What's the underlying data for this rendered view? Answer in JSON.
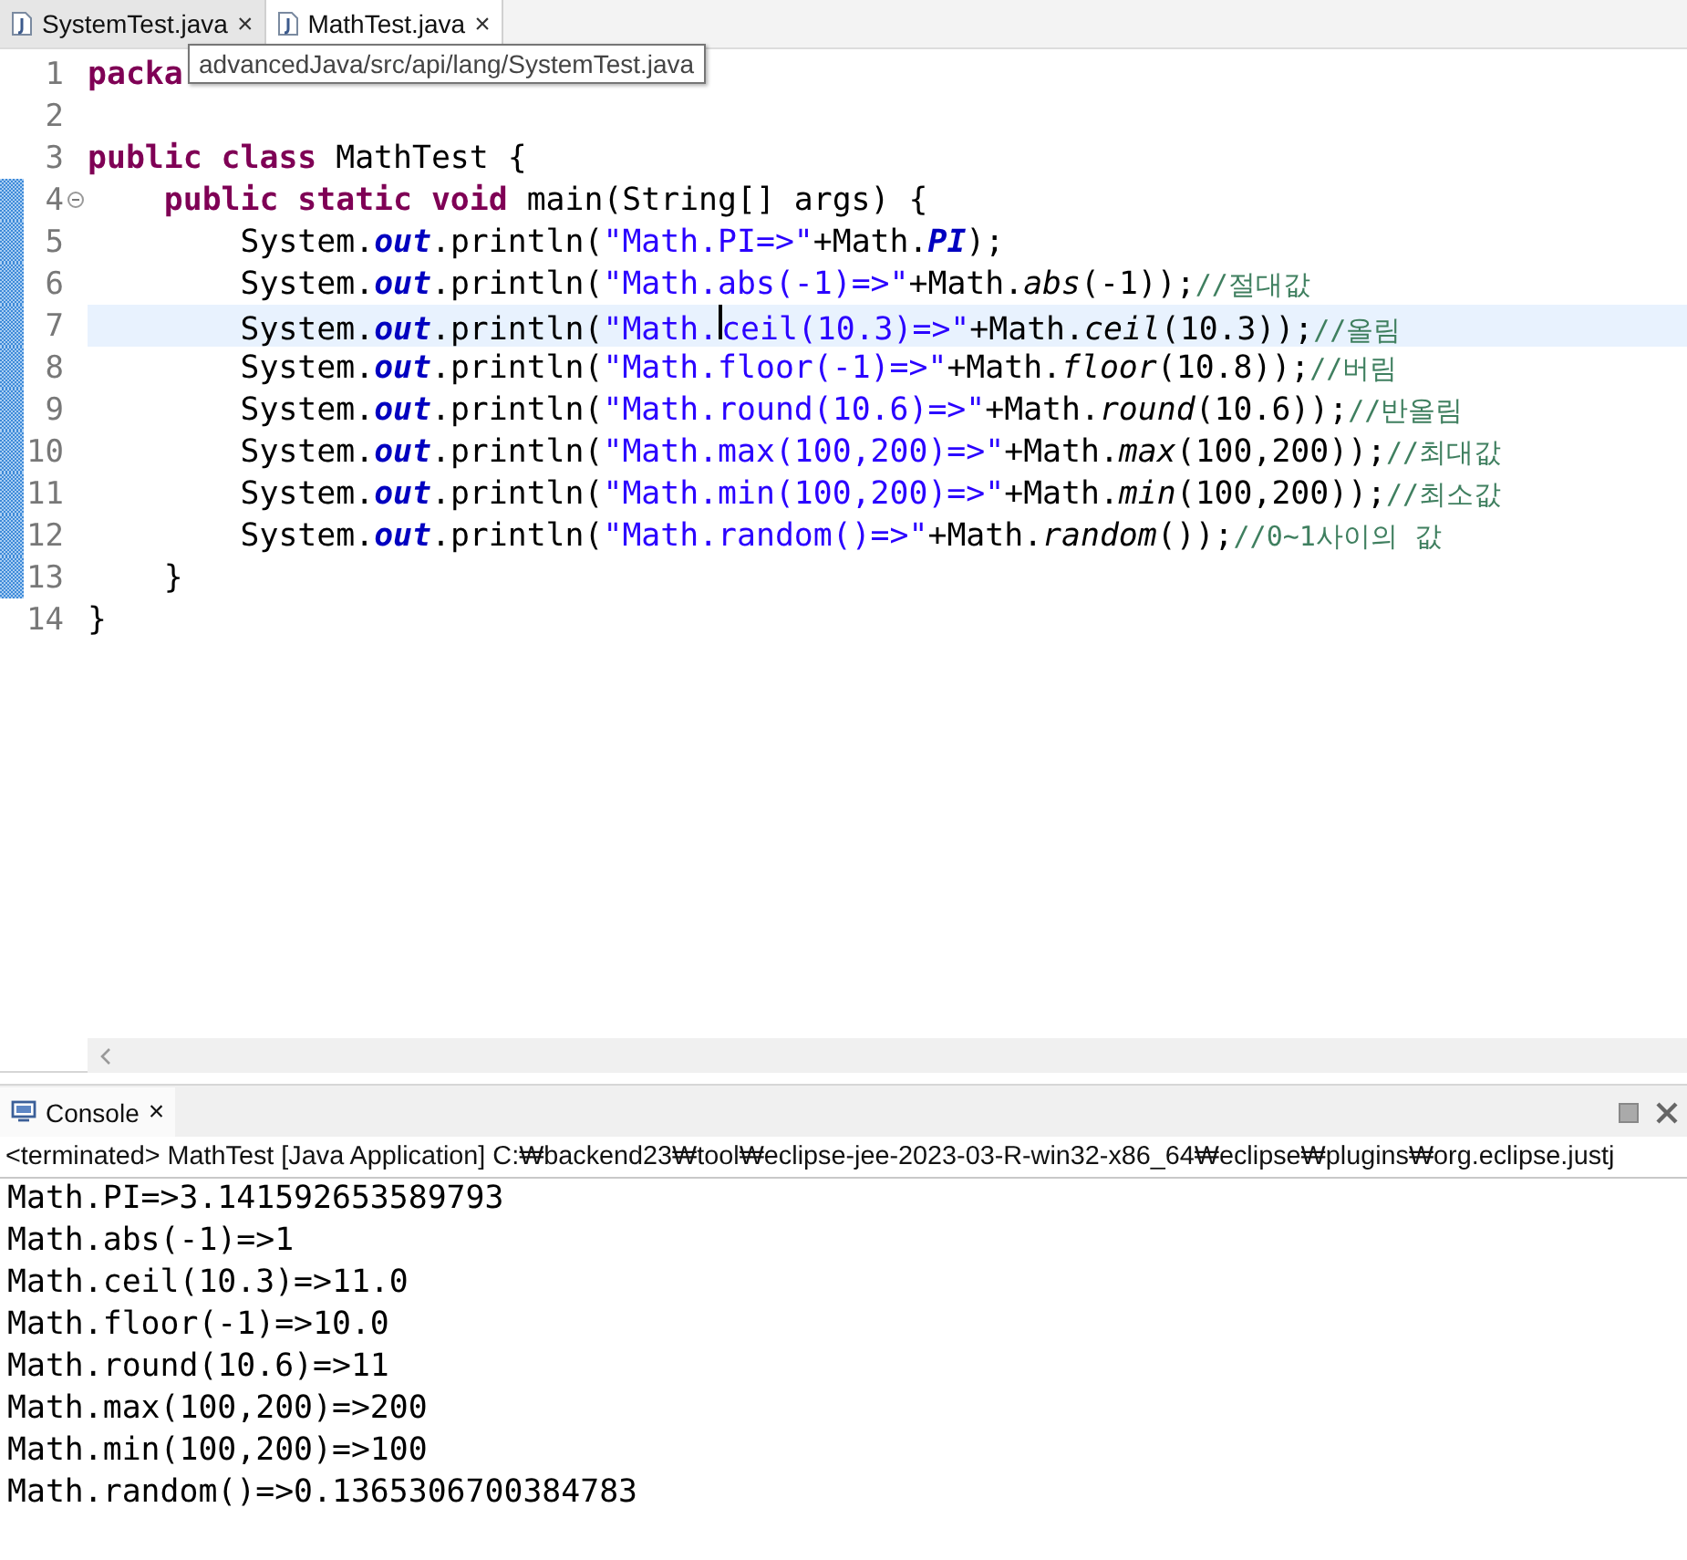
{
  "editor_tabs": [
    {
      "label": "SystemTest.java",
      "selected": false,
      "close": "×"
    },
    {
      "label": "MathTest.java",
      "selected": true,
      "close": "×"
    }
  ],
  "tooltip": "advancedJava/src/api/lang/SystemTest.java",
  "lines": [
    {
      "number": "1",
      "changed": false,
      "current": false,
      "tokens": [
        {
          "kind": "keyword",
          "text": "packa"
        }
      ]
    },
    {
      "number": "2",
      "changed": false,
      "current": false
    },
    {
      "number": "3",
      "changed": false,
      "current": false,
      "tokens": [
        {
          "kind": "keyword",
          "text": "public class"
        },
        {
          "kind": "plain",
          "text": " MathTest {"
        }
      ]
    },
    {
      "number": "4",
      "changed": true,
      "current": false,
      "collapsed": false,
      "tokens": [
        {
          "kind": "keyword",
          "text": "    public static void"
        },
        {
          "kind": "plain",
          "text": " main(String[] args) {"
        }
      ]
    },
    {
      "number": "5",
      "changed": true,
      "current": false,
      "tokens": [
        {
          "kind": "plain",
          "text": "        System."
        },
        {
          "kind": "field",
          "text": "out"
        },
        {
          "kind": "plain",
          "text": ".println("
        },
        {
          "kind": "string",
          "text": "\"Math.PI=>\""
        },
        {
          "kind": "plain",
          "text": "+Math."
        },
        {
          "kind": "field",
          "text": "PI"
        },
        {
          "kind": "plain",
          "text": ");"
        }
      ]
    },
    {
      "number": "6",
      "changed": true,
      "current": false,
      "tokens": [
        {
          "kind": "plain",
          "text": "        System."
        },
        {
          "kind": "field",
          "text": "out"
        },
        {
          "kind": "plain",
          "text": ".println("
        },
        {
          "kind": "string",
          "text": "\"Math.abs(-1)=>\""
        },
        {
          "kind": "plain",
          "text": "+Math."
        },
        {
          "kind": "static",
          "text": "abs"
        },
        {
          "kind": "plain",
          "text": "(-1));"
        },
        {
          "kind": "comment",
          "text": "//절대값"
        }
      ]
    },
    {
      "number": "7",
      "changed": true,
      "current": true,
      "tokens": [
        {
          "kind": "plain",
          "text": "        System."
        },
        {
          "kind": "field",
          "text": "out"
        },
        {
          "kind": "plain",
          "text": ".println("
        },
        {
          "kind": "string",
          "text": "\"Math."
        },
        {
          "kind": "caret"
        },
        {
          "kind": "string",
          "text": "ceil(10.3)=>\""
        },
        {
          "kind": "plain",
          "text": "+Math."
        },
        {
          "kind": "static",
          "text": "ceil"
        },
        {
          "kind": "plain",
          "text": "(10.3));"
        },
        {
          "kind": "comment",
          "text": "//올림"
        }
      ]
    },
    {
      "number": "8",
      "changed": true,
      "current": false,
      "tokens": [
        {
          "kind": "plain",
          "text": "        System."
        },
        {
          "kind": "field",
          "text": "out"
        },
        {
          "kind": "plain",
          "text": ".println("
        },
        {
          "kind": "string",
          "text": "\"Math.floor(-1)=>\""
        },
        {
          "kind": "plain",
          "text": "+Math."
        },
        {
          "kind": "static",
          "text": "floor"
        },
        {
          "kind": "plain",
          "text": "(10.8));"
        },
        {
          "kind": "comment",
          "text": "//버림"
        }
      ]
    },
    {
      "number": "9",
      "changed": true,
      "current": false,
      "tokens": [
        {
          "kind": "plain",
          "text": "        System."
        },
        {
          "kind": "field",
          "text": "out"
        },
        {
          "kind": "plain",
          "text": ".println("
        },
        {
          "kind": "string",
          "text": "\"Math.round(10.6)=>\""
        },
        {
          "kind": "plain",
          "text": "+Math."
        },
        {
          "kind": "static",
          "text": "round"
        },
        {
          "kind": "plain",
          "text": "(10.6));"
        },
        {
          "kind": "comment",
          "text": "//반올림"
        }
      ]
    },
    {
      "number": "10",
      "changed": true,
      "current": false,
      "tokens": [
        {
          "kind": "plain",
          "text": "        System."
        },
        {
          "kind": "field",
          "text": "out"
        },
        {
          "kind": "plain",
          "text": ".println("
        },
        {
          "kind": "string",
          "text": "\"Math.max(100,200)=>\""
        },
        {
          "kind": "plain",
          "text": "+Math."
        },
        {
          "kind": "static",
          "text": "max"
        },
        {
          "kind": "plain",
          "text": "(100,200));"
        },
        {
          "kind": "comment",
          "text": "//최대값"
        }
      ]
    },
    {
      "number": "11",
      "changed": true,
      "current": false,
      "tokens": [
        {
          "kind": "plain",
          "text": "        System."
        },
        {
          "kind": "field",
          "text": "out"
        },
        {
          "kind": "plain",
          "text": ".println("
        },
        {
          "kind": "string",
          "text": "\"Math.min(100,200)=>\""
        },
        {
          "kind": "plain",
          "text": "+Math."
        },
        {
          "kind": "static",
          "text": "min"
        },
        {
          "kind": "plain",
          "text": "(100,200));"
        },
        {
          "kind": "comment",
          "text": "//최소값"
        }
      ]
    },
    {
      "number": "12",
      "changed": true,
      "current": false,
      "tokens": [
        {
          "kind": "plain",
          "text": "        System."
        },
        {
          "kind": "field",
          "text": "out"
        },
        {
          "kind": "plain",
          "text": ".println("
        },
        {
          "kind": "string",
          "text": "\"Math.random()=>\""
        },
        {
          "kind": "plain",
          "text": "+Math."
        },
        {
          "kind": "static",
          "text": "random"
        },
        {
          "kind": "plain",
          "text": "());"
        },
        {
          "kind": "comment",
          "text": "//0~1사이의 값"
        }
      ]
    },
    {
      "number": "13",
      "changed": true,
      "current": false,
      "tokens": [
        {
          "kind": "plain",
          "text": "    }"
        }
      ]
    },
    {
      "number": "14",
      "changed": false,
      "current": false,
      "tokens": [
        {
          "kind": "plain",
          "text": "}"
        }
      ]
    }
  ],
  "console": {
    "tab": {
      "label": "Console",
      "close": "×",
      "selected": true
    },
    "status": "<terminated> MathTest [Java Application] C:₩backend23₩tool₩eclipse-jee-2023-03-R-win32-x86_64₩eclipse₩plugins₩org.eclipse.justj",
    "output": [
      "Math.PI=>3.141592653589793",
      "Math.abs(-1)=>1",
      "Math.ceil(10.3)=>11.0",
      "Math.floor(-1)=>10.0",
      "Math.round(10.6)=>11",
      "Math.max(100,200)=>200",
      "Math.min(100,200)=>100",
      "Math.random()=>0.1365306700384783"
    ]
  }
}
